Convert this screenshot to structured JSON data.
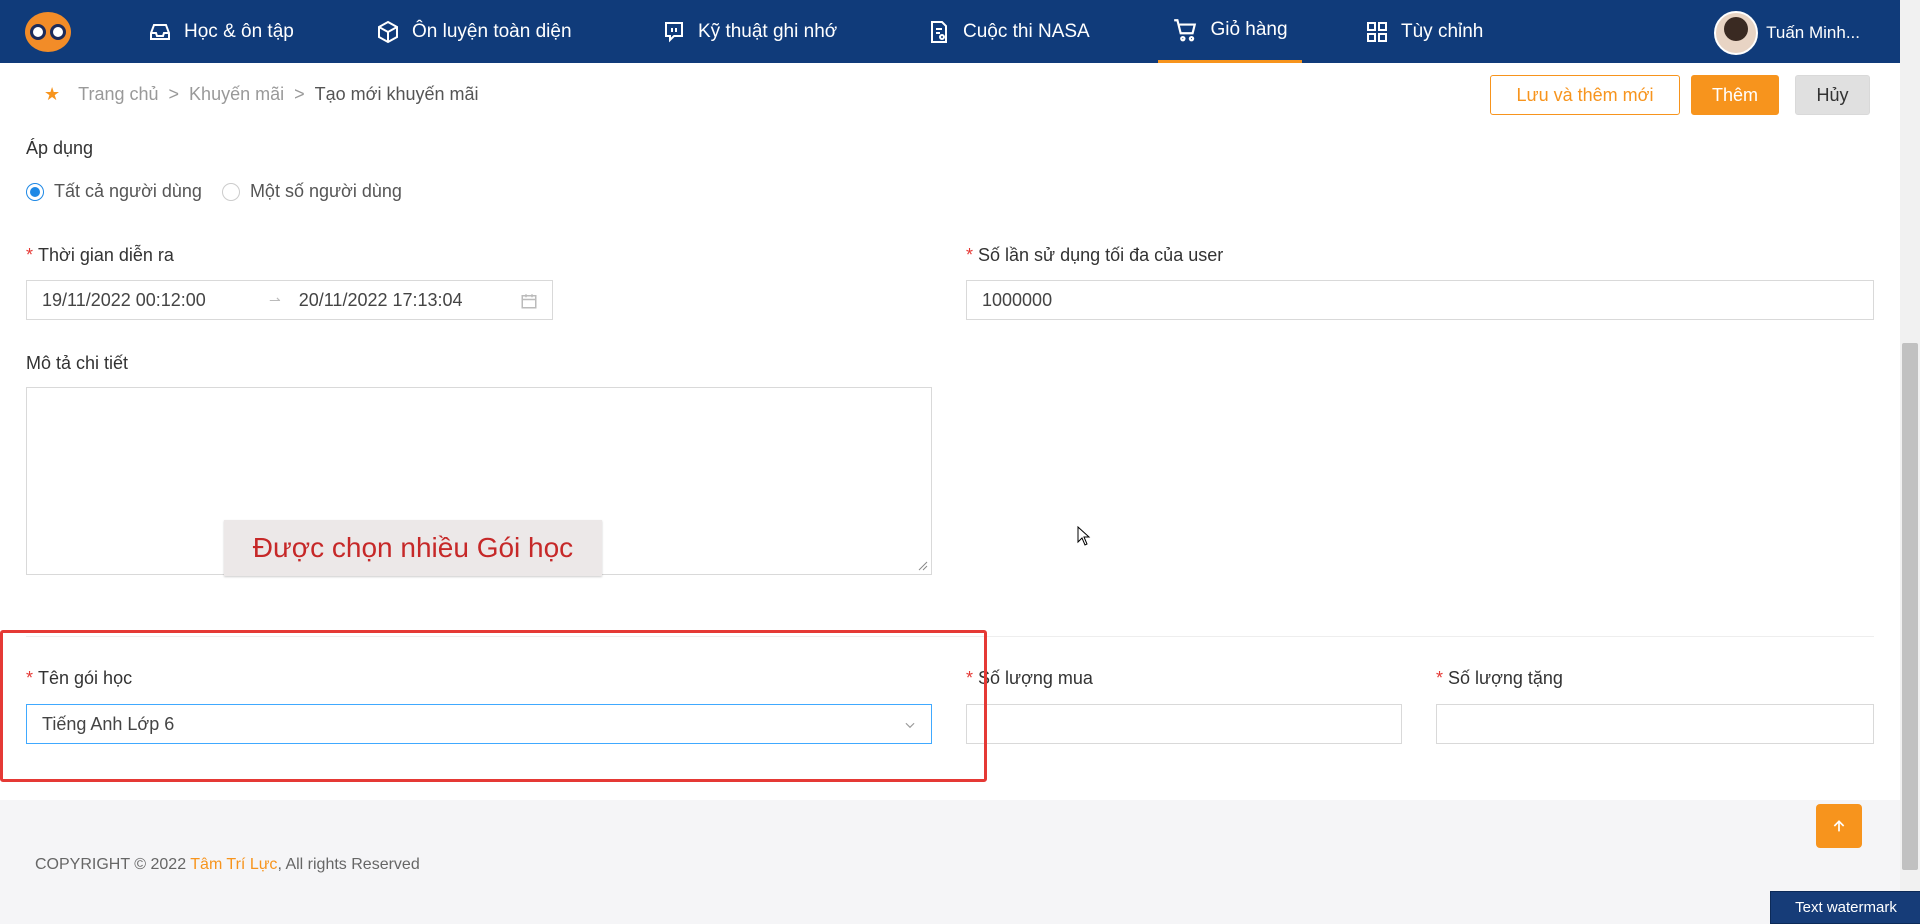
{
  "nav": {
    "items": [
      {
        "label": "Học & ôn tập",
        "icon": "inbox-icon"
      },
      {
        "label": "Ôn luyện toàn diện",
        "icon": "box-icon"
      },
      {
        "label": "Kỹ thuật ghi nhớ",
        "icon": "chat-icon"
      },
      {
        "label": "Cuộc thi NASA",
        "icon": "document-icon"
      },
      {
        "label": "Giỏ hàng",
        "icon": "cart-icon"
      },
      {
        "label": "Tùy chỉnh",
        "icon": "grid-icon"
      }
    ],
    "active": "Giỏ hàng",
    "user_name": "Tuấn Minh...",
    "accent": "#f7941d",
    "bg": "#103b7a"
  },
  "breadcrumb": {
    "home": "Trang chủ",
    "section": "Khuyến mãi",
    "current": "Tạo mới khuyến mãi",
    "separator": ">"
  },
  "actions": {
    "save_add": "Lưu và thêm mới",
    "add": "Thêm",
    "cancel": "Hủy"
  },
  "form": {
    "apply_label": "Áp dụng",
    "apply_options": [
      "Tất cả người dùng",
      "Một số người dùng"
    ],
    "apply_selected": "Tất cả người dùng",
    "time_label": "Thời gian diễn ra",
    "time_start": "19/11/2022 00:12:00",
    "time_end": "20/11/2022 17:13:04",
    "max_use_label": "Số lần sử dụng tối đa của user",
    "max_use_value": "1000000",
    "desc_label": "Mô tả chi tiết",
    "desc_value": "",
    "package_label": "Tên gói học",
    "package_value": "Tiếng Anh Lớp 6",
    "buy_qty_label": "Số lượng mua",
    "buy_qty_value": "",
    "gift_qty_label": "Số lượng tặng",
    "gift_qty_value": ""
  },
  "annotation": {
    "tooltip": "Được chọn nhiều Gói học"
  },
  "footer": {
    "prefix": "COPYRIGHT © 2022 ",
    "brand": "Tâm Trí Lực",
    "suffix": ", All rights Reserved"
  },
  "watermark": "Text watermark"
}
